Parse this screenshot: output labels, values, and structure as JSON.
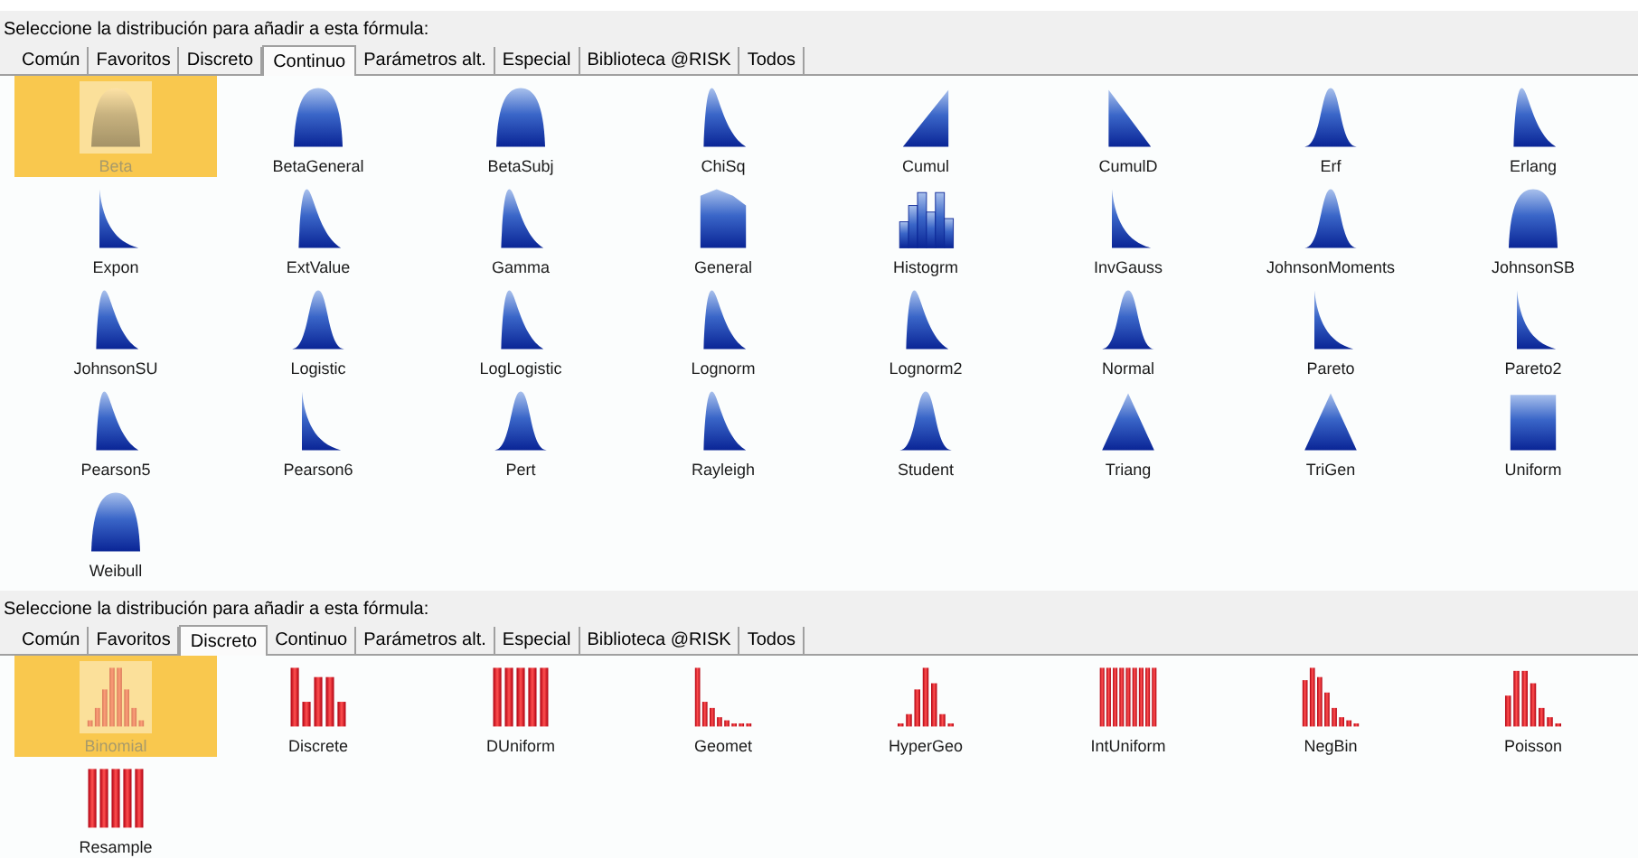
{
  "panels": [
    {
      "prompt": "Seleccione la distribución para añadir a esta fórmula:",
      "tabs": [
        {
          "label": "Común",
          "selected": false
        },
        {
          "label": "Favoritos",
          "selected": false
        },
        {
          "label": "Discreto",
          "selected": false
        },
        {
          "label": "Continuo",
          "selected": true
        },
        {
          "label": "Parámetros alt.",
          "selected": false
        },
        {
          "label": "Especial",
          "selected": false
        },
        {
          "label": "Biblioteca @RISK",
          "selected": false
        },
        {
          "label": "Todos",
          "selected": false
        }
      ],
      "items": [
        {
          "label": "Beta",
          "kind": "wide",
          "selected": true
        },
        {
          "label": "BetaGeneral",
          "kind": "wide",
          "selected": false
        },
        {
          "label": "BetaSubj",
          "kind": "wide",
          "selected": false
        },
        {
          "label": "ChiSq",
          "kind": "skew",
          "selected": false
        },
        {
          "label": "Cumul",
          "kind": "ramp-up",
          "selected": false
        },
        {
          "label": "CumulD",
          "kind": "ramp-down",
          "selected": false
        },
        {
          "label": "Erf",
          "kind": "bell",
          "selected": false
        },
        {
          "label": "Erlang",
          "kind": "skew",
          "selected": false
        },
        {
          "label": "Expon",
          "kind": "decay",
          "selected": false
        },
        {
          "label": "ExtValue",
          "kind": "skew",
          "selected": false
        },
        {
          "label": "Gamma",
          "kind": "skew",
          "selected": false
        },
        {
          "label": "General",
          "kind": "block",
          "selected": false
        },
        {
          "label": "Histogrm",
          "kind": "histogram",
          "selected": false
        },
        {
          "label": "InvGauss",
          "kind": "decay",
          "selected": false
        },
        {
          "label": "JohnsonMoments",
          "kind": "bell",
          "selected": false
        },
        {
          "label": "JohnsonSB",
          "kind": "wide",
          "selected": false
        },
        {
          "label": "JohnsonSU",
          "kind": "skew",
          "selected": false
        },
        {
          "label": "Logistic",
          "kind": "bell",
          "selected": false
        },
        {
          "label": "LogLogistic",
          "kind": "skew",
          "selected": false
        },
        {
          "label": "Lognorm",
          "kind": "skew",
          "selected": false
        },
        {
          "label": "Lognorm2",
          "kind": "skew",
          "selected": false
        },
        {
          "label": "Normal",
          "kind": "bell",
          "selected": false
        },
        {
          "label": "Pareto",
          "kind": "decay",
          "selected": false
        },
        {
          "label": "Pareto2",
          "kind": "decay",
          "selected": false
        },
        {
          "label": "Pearson5",
          "kind": "skew",
          "selected": false
        },
        {
          "label": "Pearson6",
          "kind": "decay",
          "selected": false
        },
        {
          "label": "Pert",
          "kind": "bell",
          "selected": false
        },
        {
          "label": "Rayleigh",
          "kind": "skew",
          "selected": false
        },
        {
          "label": "Student",
          "kind": "bell",
          "selected": false
        },
        {
          "label": "Triang",
          "kind": "tri",
          "selected": false
        },
        {
          "label": "TriGen",
          "kind": "tri",
          "selected": false
        },
        {
          "label": "Uniform",
          "kind": "flat",
          "selected": false
        },
        {
          "label": "Weibull",
          "kind": "wide",
          "selected": false
        }
      ]
    },
    {
      "prompt": "Seleccione la distribución para añadir a esta fórmula:",
      "tabs": [
        {
          "label": "Común",
          "selected": false
        },
        {
          "label": "Favoritos",
          "selected": false
        },
        {
          "label": "Discreto",
          "selected": true
        },
        {
          "label": "Continuo",
          "selected": false
        },
        {
          "label": "Parámetros alt.",
          "selected": false
        },
        {
          "label": "Especial",
          "selected": false
        },
        {
          "label": "Biblioteca @RISK",
          "selected": false
        },
        {
          "label": "Todos",
          "selected": false
        }
      ],
      "items": [
        {
          "label": "Binomial",
          "kind": "binomial",
          "selected": true
        },
        {
          "label": "Discrete",
          "kind": "spread",
          "selected": false
        },
        {
          "label": "DUniform",
          "kind": "uniform5",
          "selected": false
        },
        {
          "label": "Geomet",
          "kind": "geometric",
          "selected": false
        },
        {
          "label": "HyperGeo",
          "kind": "hypergeo",
          "selected": false
        },
        {
          "label": "IntUniform",
          "kind": "uniform9",
          "selected": false
        },
        {
          "label": "NegBin",
          "kind": "negbin",
          "selected": false
        },
        {
          "label": "Poisson",
          "kind": "poisson",
          "selected": false
        },
        {
          "label": "Resample",
          "kind": "uniform5",
          "selected": false
        }
      ]
    }
  ]
}
